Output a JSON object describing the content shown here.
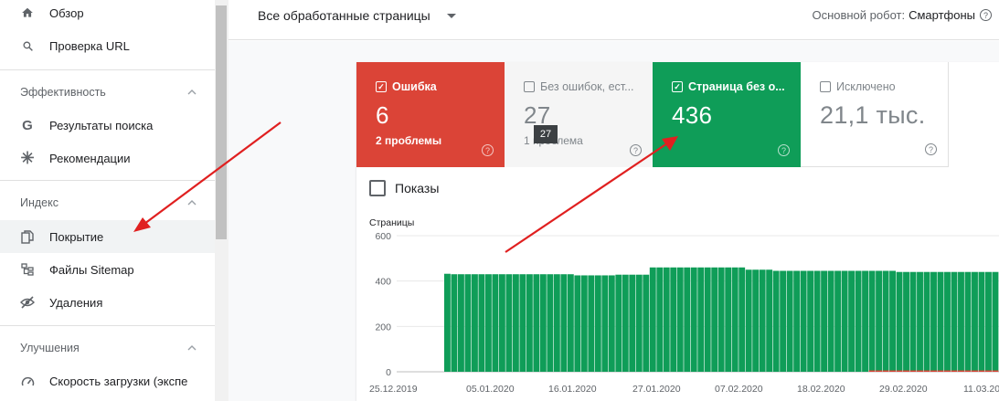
{
  "sidebar": {
    "items_top": [
      {
        "label": "Обзор",
        "icon": "home-icon"
      },
      {
        "label": "Проверка URL",
        "icon": "search-icon"
      }
    ],
    "sections": [
      {
        "title": "Эффективность",
        "items": [
          {
            "label": "Результаты поиска",
            "icon": "google-g-icon"
          },
          {
            "label": "Рекомендации",
            "icon": "asterisk-icon"
          }
        ]
      },
      {
        "title": "Индекс",
        "items": [
          {
            "label": "Покрытие",
            "icon": "copy-pages-icon",
            "active": true
          },
          {
            "label": "Файлы Sitemap",
            "icon": "sitemap-icon"
          },
          {
            "label": "Удаления",
            "icon": "eye-off-icon"
          }
        ]
      },
      {
        "title": "Улучшения",
        "items": [
          {
            "label": "Скорость загрузки (экспе",
            "icon": "speedometer-icon"
          }
        ]
      }
    ]
  },
  "topbar": {
    "filter_label": "Все обработанные страницы",
    "crawler_label": "Основной робот:",
    "crawler_value": "Смартфоны",
    "help_glyph": "?"
  },
  "tiles": {
    "error": {
      "label": "Ошибка",
      "value": "6",
      "sub": "2 проблемы",
      "checked": true,
      "color": "#db4437"
    },
    "warning": {
      "label": "Без ошибок, ест...",
      "value": "27",
      "sub": "1 проблема",
      "checked": false,
      "color": "#f5f5f5"
    },
    "valid": {
      "label": "Страница без о...",
      "value": "436",
      "checked": true,
      "color": "#0f9d58"
    },
    "excluded": {
      "label": "Исключено",
      "value": "21,1 тыс.",
      "checked": false
    }
  },
  "tooltip": "27",
  "impressions_label": "Показы",
  "chart_data": {
    "type": "bar",
    "ylabel": "Страницы",
    "ylim": [
      0,
      600
    ],
    "yticks": [
      "600",
      "400",
      "200",
      "0"
    ],
    "x_tick_labels": [
      "25.12.2019",
      "05.01.2020",
      "16.01.2020",
      "27.01.2020",
      "07.02.2020",
      "18.02.2020",
      "29.02.2020",
      "11.03.20"
    ],
    "series": [
      {
        "color": "#0f9d58",
        "values": [
          432,
          430,
          430,
          430,
          430,
          430,
          430,
          430,
          430,
          430,
          430,
          430,
          430,
          430,
          430,
          430,
          430,
          430,
          430,
          425,
          425,
          425,
          425,
          425,
          425,
          428,
          428,
          428,
          428,
          428,
          460,
          460,
          460,
          460,
          460,
          460,
          460,
          460,
          460,
          460,
          460,
          460,
          460,
          460,
          450,
          450,
          450,
          450,
          445,
          445,
          445,
          445,
          445,
          445,
          445,
          445,
          445,
          445,
          445,
          445,
          445,
          445,
          445,
          445,
          445,
          445,
          440,
          440,
          440,
          440,
          440,
          440,
          440,
          440,
          440,
          440,
          440,
          440,
          440,
          440,
          440
        ]
      },
      {
        "color": "#db4437",
        "values": [
          0,
          0,
          0,
          0,
          0,
          0,
          0,
          0,
          0,
          0,
          0,
          0,
          0,
          0,
          0,
          0,
          0,
          0,
          0,
          0,
          0,
          0,
          0,
          0,
          0,
          0,
          0,
          0,
          0,
          0,
          0,
          0,
          0,
          0,
          0,
          0,
          0,
          0,
          0,
          0,
          0,
          0,
          0,
          0,
          0,
          0,
          0,
          0,
          0,
          0,
          0,
          0,
          0,
          0,
          0,
          0,
          0,
          0,
          0,
          0,
          0,
          0,
          6,
          6,
          6,
          6,
          6,
          6,
          6,
          6,
          6,
          6,
          6,
          6,
          6,
          6,
          6,
          6,
          6,
          6,
          6
        ]
      }
    ]
  },
  "colors": {
    "accent_green": "#0f9d58",
    "accent_red": "#db4437",
    "annotation_arrow": "#e02020"
  }
}
